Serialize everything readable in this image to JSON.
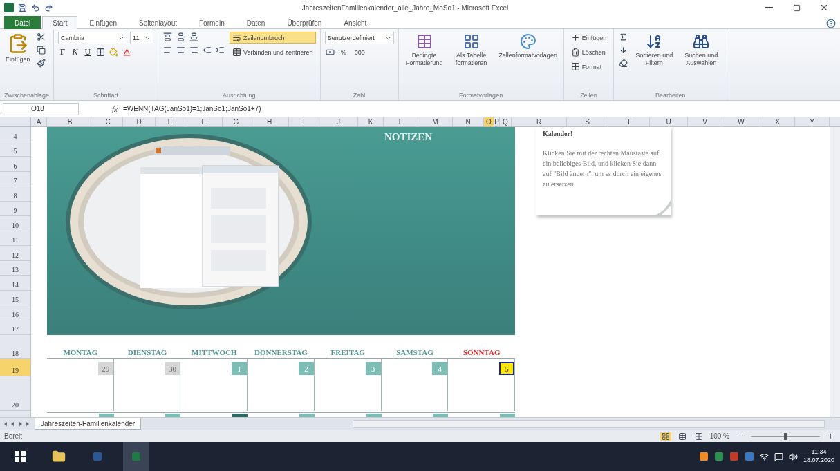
{
  "window": {
    "title": "JahreszeitenFamilienkalender_alle_Jahre_MoSo1 - Microsoft Excel"
  },
  "ribbon_tabs": [
    {
      "label": "Datei",
      "kind": "file",
      "selected": false
    },
    {
      "label": "Start",
      "kind": "tab",
      "selected": true
    },
    {
      "label": "Einfügen",
      "kind": "tab",
      "selected": false
    },
    {
      "label": "Seitenlayout",
      "kind": "tab",
      "selected": false
    },
    {
      "label": "Formeln",
      "kind": "tab",
      "selected": false
    },
    {
      "label": "Daten",
      "kind": "tab",
      "selected": false
    },
    {
      "label": "Überprüfen",
      "kind": "tab",
      "selected": false
    },
    {
      "label": "Ansicht",
      "kind": "tab",
      "selected": false
    }
  ],
  "ribbon_groups": [
    {
      "kind": "clipboard",
      "label": "Zwischenablage",
      "paste": "Einfügen"
    },
    {
      "kind": "font",
      "label": "Schriftart",
      "font_name": "Cambria",
      "font_size": "11",
      "styles": [
        "F",
        "K",
        "U"
      ]
    },
    {
      "kind": "alignment",
      "label": "Ausrichtung",
      "wrap": {
        "label": "Zeilenumbruch",
        "on": true
      },
      "merge": "Verbinden und zentrieren"
    },
    {
      "kind": "number",
      "label": "Zahl",
      "format": "Benutzerdefiniert",
      "buttons": [
        "%",
        "000"
      ]
    },
    {
      "kind": "styles",
      "label": "Formatvorlagen",
      "items": [
        "Bedingte Formatierung",
        "Als Tabelle formatieren",
        "Zellenformatvorlagen"
      ]
    },
    {
      "kind": "cells",
      "label": "Zellen",
      "items": [
        "Einfügen",
        "Löschen",
        "Format"
      ]
    },
    {
      "kind": "editing",
      "label": "Bearbeiten",
      "items": [
        "Sortieren und Filtern",
        "Suchen und Auswählen"
      ]
    }
  ],
  "formula_bar": {
    "name_box": "O18",
    "fx": "fx",
    "formula": "=WENN(TAG(JanSo1)=1;JanSo1;JanSo1+7)"
  },
  "columns": [
    {
      "label": "A",
      "selected": false
    },
    {
      "label": "B",
      "selected": false
    },
    {
      "label": "C",
      "selected": false
    },
    {
      "label": "D",
      "selected": false
    },
    {
      "label": "E",
      "selected": false
    },
    {
      "label": "F",
      "selected": false
    },
    {
      "label": "G",
      "selected": false
    },
    {
      "label": "H",
      "selected": false
    },
    {
      "label": "I",
      "selected": false
    },
    {
      "label": "J",
      "selected": false
    },
    {
      "label": "K",
      "selected": false
    },
    {
      "label": "L",
      "selected": false
    },
    {
      "label": "M",
      "selected": false
    },
    {
      "label": "N",
      "selected": false
    },
    {
      "label": "O",
      "selected": true
    },
    {
      "label": "P",
      "selected": false
    },
    {
      "label": "Q",
      "selected": false
    },
    {
      "label": "R",
      "selected": false
    },
    {
      "label": "S",
      "selected": false
    },
    {
      "label": "T",
      "selected": false
    },
    {
      "label": "U",
      "selected": false
    },
    {
      "label": "V",
      "selected": false
    },
    {
      "label": "W",
      "selected": false
    },
    {
      "label": "X",
      "selected": false
    },
    {
      "label": "Y",
      "selected": false
    }
  ],
  "rows": [
    {
      "label": "4",
      "selected": false
    },
    {
      "label": "5",
      "selected": false
    },
    {
      "label": "6",
      "selected": false
    },
    {
      "label": "7",
      "selected": false
    },
    {
      "label": "8",
      "selected": false
    },
    {
      "label": "9",
      "selected": false
    },
    {
      "label": "10",
      "selected": false
    },
    {
      "label": "11",
      "selected": false
    },
    {
      "label": "12",
      "selected": false
    },
    {
      "label": "13",
      "selected": false
    },
    {
      "label": "14",
      "selected": false
    },
    {
      "label": "15",
      "selected": false
    },
    {
      "label": "16",
      "selected": false
    },
    {
      "label": "17",
      "selected": false
    },
    {
      "label": "18",
      "selected": false
    },
    {
      "label": "19",
      "selected": true
    },
    {
      "label": "20",
      "selected": false
    }
  ],
  "banner": {
    "heading": "NOTIZEN"
  },
  "note": {
    "title": "Kalender!",
    "text": "Klicken Sie mit der rechten Maustaste auf ein beliebiges Bild, und klicken Sie dann auf \"Bild ändern\", um es durch ein eigenes zu ersetzen."
  },
  "calendar": {
    "days": [
      {
        "name": "MONTAG",
        "kind": "weekday"
      },
      {
        "name": "DIENSTAG",
        "kind": "weekday"
      },
      {
        "name": "MITTWOCH",
        "kind": "weekday"
      },
      {
        "name": "DONNERSTAG",
        "kind": "weekday"
      },
      {
        "name": "FREITAG",
        "kind": "weekday"
      },
      {
        "name": "SAMSTAG",
        "kind": "weekday"
      },
      {
        "name": "SONNTAG",
        "kind": "sunday"
      }
    ],
    "week": [
      {
        "label": "29",
        "kind": "other_month",
        "selected": false
      },
      {
        "label": "30",
        "kind": "other_month",
        "selected": false
      },
      {
        "label": "1",
        "kind": "current",
        "selected": false
      },
      {
        "label": "2",
        "kind": "current",
        "selected": false
      },
      {
        "label": "3",
        "kind": "current",
        "selected": false
      },
      {
        "label": "4",
        "kind": "current",
        "selected": false
      },
      {
        "label": "5",
        "kind": "current",
        "selected": true
      }
    ],
    "next_week": [
      {
        "today": false
      },
      {
        "today": false
      },
      {
        "today": true
      },
      {
        "today": false
      },
      {
        "today": false
      },
      {
        "today": false
      },
      {
        "today": false
      }
    ]
  },
  "sheet_tabs": [
    {
      "label": "Jahreszeiten-Familienkalender",
      "selected": true
    }
  ],
  "status_bar": {
    "mode": "Bereit",
    "zoom": "100 %",
    "zoom_slider": {
      "level": 0.5
    }
  },
  "taskbar": {
    "time": "11:34",
    "date": "18.07.2020"
  }
}
